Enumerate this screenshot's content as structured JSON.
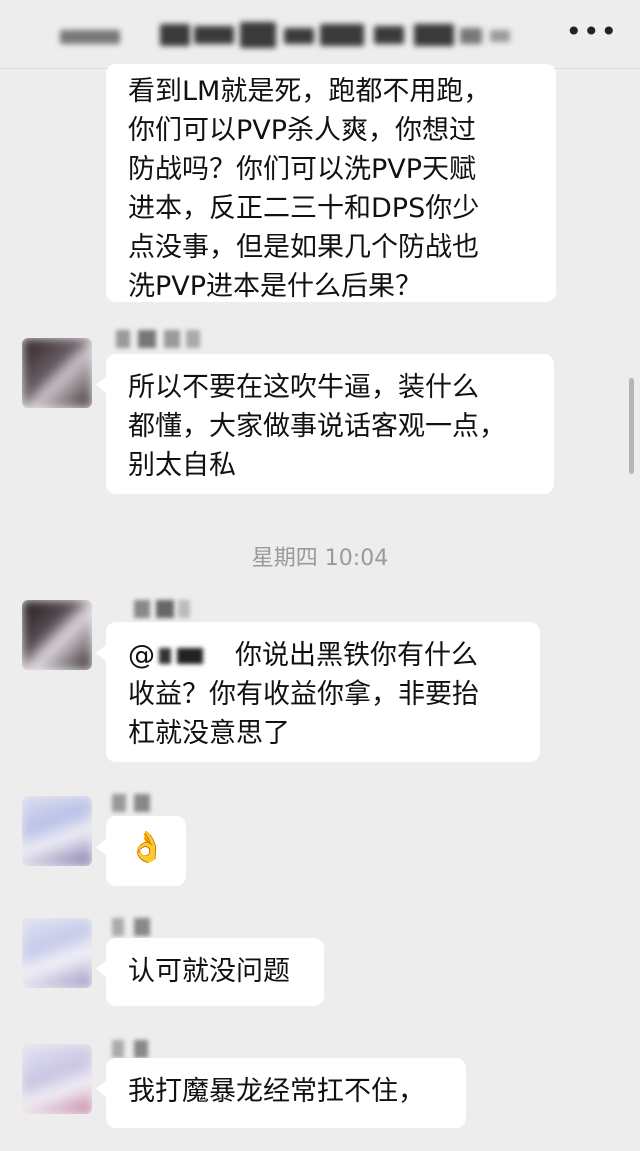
{
  "header": {
    "more_icon": "more-icon"
  },
  "messages": [
    {
      "id": "m1",
      "lines": [
        "看到LM就是死，跑都不用跑，",
        "你们可以PVP杀人爽，你想过",
        "防战吗？你们可以洗PVP天赋",
        "进本，反正二三十和DPS你少",
        "点没事，但是如果几个防战也",
        "洗PVP进本是什么后果？"
      ]
    },
    {
      "id": "m2",
      "lines": [
        "所以不要在这吹牛逼，装什么",
        "都懂，大家做事说话客观一点，",
        "别太自私"
      ]
    },
    {
      "id": "m3",
      "mention_prefix": "@",
      "lines": [
        "你说出黑铁你有什么",
        "收益？你有收益你拿，非要抬",
        "杠就没意思了"
      ]
    },
    {
      "id": "m4",
      "emoji": "👌"
    },
    {
      "id": "m5",
      "lines": [
        "认可就没问题"
      ]
    },
    {
      "id": "m6",
      "lines": [
        "我打魔暴龙经常扛不住，"
      ]
    }
  ],
  "timestamp": "星期四 10:04",
  "colors": {
    "background": "#ededed",
    "bubble": "#ffffff",
    "timestamp": "#9a9a9a"
  }
}
